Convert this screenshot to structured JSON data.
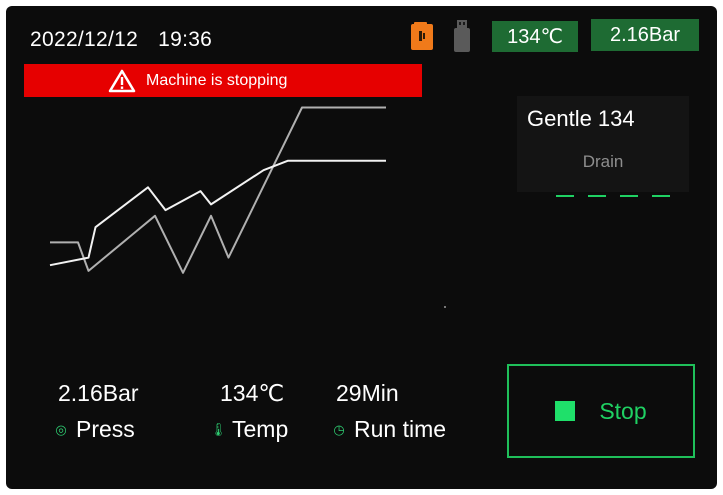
{
  "status_bar": {
    "date": "2022/12/12",
    "time": "19:36",
    "door_icon": "door-lock-icon",
    "usb_icon": "usb-drive-icon",
    "temperature_badge": "134℃",
    "pressure_badge": "2.16Bar"
  },
  "alarm": {
    "icon": "warning-icon",
    "message": "Machine is stopping"
  },
  "program": {
    "name": "Gentle 134",
    "phase": "Drain",
    "phase_steps_total": 4
  },
  "chart_data": {
    "type": "line",
    "title": "",
    "xlabel": "",
    "ylabel": "",
    "x_range": [
      0,
      100
    ],
    "y_range": [
      0,
      100
    ],
    "grid": false,
    "legend": "none",
    "series": [
      {
        "color": "#b0b0b0",
        "points": [
          [
            4,
            24
          ],
          [
            12,
            24
          ],
          [
            15,
            9
          ],
          [
            34,
            38
          ],
          [
            42,
            8
          ],
          [
            50,
            38
          ],
          [
            55,
            16
          ],
          [
            76,
            95
          ],
          [
            100,
            95
          ]
        ]
      },
      {
        "color": "#f2f2f2",
        "points": [
          [
            4,
            12
          ],
          [
            15,
            16
          ],
          [
            17,
            32
          ],
          [
            32,
            53
          ],
          [
            37,
            41
          ],
          [
            47,
            51
          ],
          [
            50,
            44
          ],
          [
            65,
            62
          ],
          [
            72,
            67
          ],
          [
            100,
            67
          ]
        ]
      }
    ]
  },
  "readouts": {
    "pressure_value": "2.16Bar",
    "pressure_label": "Press",
    "pressure_icon": "gauge-icon",
    "temp_value": "134℃",
    "temp_label": "Temp",
    "temp_icon": "thermometer-icon",
    "time_value": "29Min",
    "time_label": "Run time",
    "time_icon": "clock-icon"
  },
  "controls": {
    "stop_label": "Stop",
    "stop_icon": "stop-square-icon"
  },
  "colors": {
    "screen_bg": "#0c0c0c",
    "badge_green": "#1e6b33",
    "alarm_red": "#e60000",
    "accent_green": "#1fd163",
    "door_orange": "#f07a1a"
  }
}
